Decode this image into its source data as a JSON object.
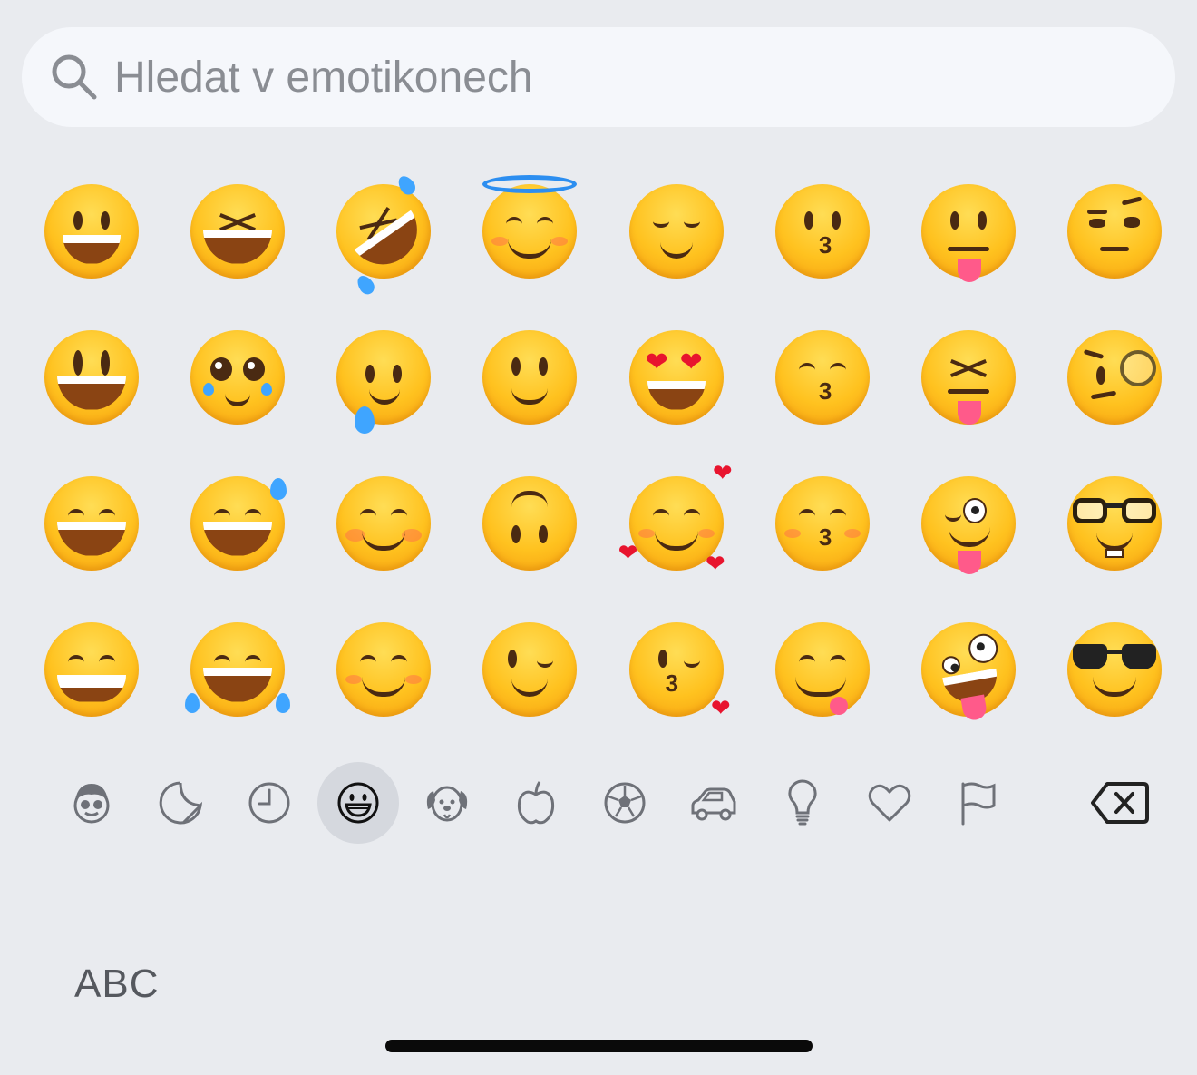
{
  "search": {
    "placeholder": "Hledat v emotikonech"
  },
  "emoji_rows": [
    [
      "grinning-face",
      "grinning-squinting-face",
      "rolling-on-floor-laughing",
      "smiling-face-with-halo",
      "relieved-face",
      "kissing-face",
      "face-with-tongue",
      "face-with-raised-eyebrow"
    ],
    [
      "grinning-face-with-big-eyes",
      "pleading-face",
      "face-holding-back-tears",
      "slightly-smiling-face",
      "smiling-face-with-heart-eyes",
      "kissing-face-with-smiling-eyes",
      "squinting-face-with-tongue",
      "face-with-monocle"
    ],
    [
      "grinning-face-with-smiling-eyes",
      "grinning-face-with-sweat",
      "smiling-face",
      "upside-down-face",
      "smiling-face-with-hearts",
      "kissing-face-with-closed-eyes",
      "winking-face-with-tongue",
      "nerd-face"
    ],
    [
      "beaming-face-with-smiling-eyes",
      "face-with-tears-of-joy",
      "smiling-face-with-smiling-eyes",
      "winking-face",
      "face-blowing-a-kiss",
      "face-savoring-food",
      "zany-face",
      "smiling-face-with-sunglasses"
    ]
  ],
  "categories": [
    {
      "icon": "memoji-icon"
    },
    {
      "icon": "sticker-icon"
    },
    {
      "icon": "recent-clock-icon"
    },
    {
      "icon": "smileys-icon",
      "active": true
    },
    {
      "icon": "animals-icon"
    },
    {
      "icon": "food-apple-icon"
    },
    {
      "icon": "activity-ball-icon"
    },
    {
      "icon": "travel-car-icon"
    },
    {
      "icon": "objects-bulb-icon"
    },
    {
      "icon": "symbols-heart-icon"
    },
    {
      "icon": "flags-icon"
    },
    {
      "icon": "backspace-icon"
    }
  ],
  "keyboard": {
    "abc_label": "ABC"
  },
  "colors": {
    "background": "#e9ebef",
    "search_bg": "#f5f7fb",
    "icon_gray": "#6e7178",
    "active_category_bg": "#d5d8de"
  }
}
